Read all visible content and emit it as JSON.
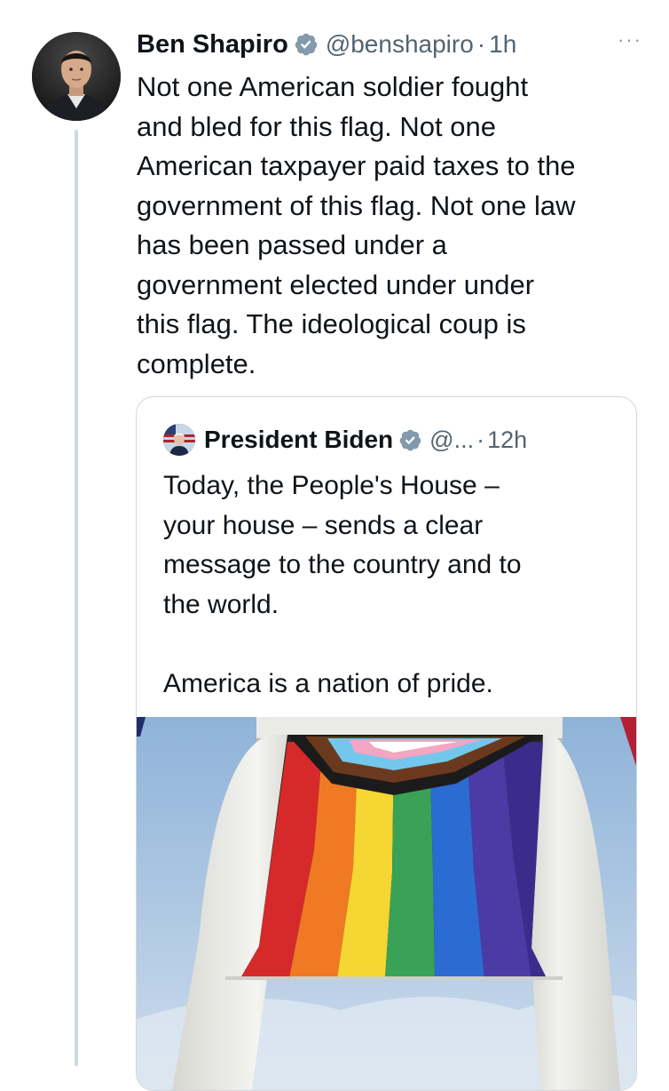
{
  "tweet": {
    "author": {
      "display_name": "Ben Shapiro",
      "handle": "@benshapiro",
      "verified": true,
      "avatar_icon": "profile-photo"
    },
    "separator": "·",
    "time": "1h",
    "more_label": "···",
    "text": "Not one American soldier fought\nand bled for this flag. Not one\nAmerican taxpayer paid taxes to the\ngovernment of this flag. Not one law\nhas been passed under a\ngovernment elected under under\nthis flag. The ideological coup is\ncomplete."
  },
  "quoted_tweet": {
    "author": {
      "display_name": "President Biden",
      "handle": "@...",
      "verified": true
    },
    "separator": "·",
    "time": "12h",
    "text": "Today, the People's House –\nyour house – sends a clear\nmessage to the country and to\nthe world.\n\nAmerica is a nation of pride.",
    "media": {
      "kind": "photo",
      "subject": "progress-pride-flag-between-columns"
    }
  },
  "colors": {
    "text_primary": "#0f1419",
    "text_secondary": "#536471",
    "verified_badge": "#829aab",
    "border": "#cfd9de",
    "thread_line": "#cfd9de"
  }
}
